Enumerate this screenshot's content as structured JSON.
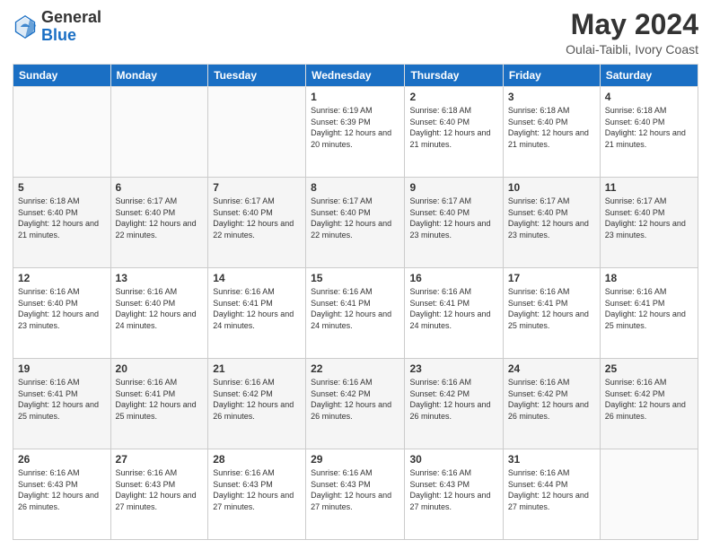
{
  "header": {
    "logo_general": "General",
    "logo_blue": "Blue",
    "month_title": "May 2024",
    "location": "Oulai-Taibli, Ivory Coast"
  },
  "weekdays": [
    "Sunday",
    "Monday",
    "Tuesday",
    "Wednesday",
    "Thursday",
    "Friday",
    "Saturday"
  ],
  "weeks": [
    [
      {
        "day": "",
        "info": ""
      },
      {
        "day": "",
        "info": ""
      },
      {
        "day": "",
        "info": ""
      },
      {
        "day": "1",
        "info": "Sunrise: 6:19 AM\nSunset: 6:39 PM\nDaylight: 12 hours and 20 minutes."
      },
      {
        "day": "2",
        "info": "Sunrise: 6:18 AM\nSunset: 6:40 PM\nDaylight: 12 hours and 21 minutes."
      },
      {
        "day": "3",
        "info": "Sunrise: 6:18 AM\nSunset: 6:40 PM\nDaylight: 12 hours and 21 minutes."
      },
      {
        "day": "4",
        "info": "Sunrise: 6:18 AM\nSunset: 6:40 PM\nDaylight: 12 hours and 21 minutes."
      }
    ],
    [
      {
        "day": "5",
        "info": "Sunrise: 6:18 AM\nSunset: 6:40 PM\nDaylight: 12 hours and 21 minutes."
      },
      {
        "day": "6",
        "info": "Sunrise: 6:17 AM\nSunset: 6:40 PM\nDaylight: 12 hours and 22 minutes."
      },
      {
        "day": "7",
        "info": "Sunrise: 6:17 AM\nSunset: 6:40 PM\nDaylight: 12 hours and 22 minutes."
      },
      {
        "day": "8",
        "info": "Sunrise: 6:17 AM\nSunset: 6:40 PM\nDaylight: 12 hours and 22 minutes."
      },
      {
        "day": "9",
        "info": "Sunrise: 6:17 AM\nSunset: 6:40 PM\nDaylight: 12 hours and 23 minutes."
      },
      {
        "day": "10",
        "info": "Sunrise: 6:17 AM\nSunset: 6:40 PM\nDaylight: 12 hours and 23 minutes."
      },
      {
        "day": "11",
        "info": "Sunrise: 6:17 AM\nSunset: 6:40 PM\nDaylight: 12 hours and 23 minutes."
      }
    ],
    [
      {
        "day": "12",
        "info": "Sunrise: 6:16 AM\nSunset: 6:40 PM\nDaylight: 12 hours and 23 minutes."
      },
      {
        "day": "13",
        "info": "Sunrise: 6:16 AM\nSunset: 6:40 PM\nDaylight: 12 hours and 24 minutes."
      },
      {
        "day": "14",
        "info": "Sunrise: 6:16 AM\nSunset: 6:41 PM\nDaylight: 12 hours and 24 minutes."
      },
      {
        "day": "15",
        "info": "Sunrise: 6:16 AM\nSunset: 6:41 PM\nDaylight: 12 hours and 24 minutes."
      },
      {
        "day": "16",
        "info": "Sunrise: 6:16 AM\nSunset: 6:41 PM\nDaylight: 12 hours and 24 minutes."
      },
      {
        "day": "17",
        "info": "Sunrise: 6:16 AM\nSunset: 6:41 PM\nDaylight: 12 hours and 25 minutes."
      },
      {
        "day": "18",
        "info": "Sunrise: 6:16 AM\nSunset: 6:41 PM\nDaylight: 12 hours and 25 minutes."
      }
    ],
    [
      {
        "day": "19",
        "info": "Sunrise: 6:16 AM\nSunset: 6:41 PM\nDaylight: 12 hours and 25 minutes."
      },
      {
        "day": "20",
        "info": "Sunrise: 6:16 AM\nSunset: 6:41 PM\nDaylight: 12 hours and 25 minutes."
      },
      {
        "day": "21",
        "info": "Sunrise: 6:16 AM\nSunset: 6:42 PM\nDaylight: 12 hours and 26 minutes."
      },
      {
        "day": "22",
        "info": "Sunrise: 6:16 AM\nSunset: 6:42 PM\nDaylight: 12 hours and 26 minutes."
      },
      {
        "day": "23",
        "info": "Sunrise: 6:16 AM\nSunset: 6:42 PM\nDaylight: 12 hours and 26 minutes."
      },
      {
        "day": "24",
        "info": "Sunrise: 6:16 AM\nSunset: 6:42 PM\nDaylight: 12 hours and 26 minutes."
      },
      {
        "day": "25",
        "info": "Sunrise: 6:16 AM\nSunset: 6:42 PM\nDaylight: 12 hours and 26 minutes."
      }
    ],
    [
      {
        "day": "26",
        "info": "Sunrise: 6:16 AM\nSunset: 6:43 PM\nDaylight: 12 hours and 26 minutes."
      },
      {
        "day": "27",
        "info": "Sunrise: 6:16 AM\nSunset: 6:43 PM\nDaylight: 12 hours and 27 minutes."
      },
      {
        "day": "28",
        "info": "Sunrise: 6:16 AM\nSunset: 6:43 PM\nDaylight: 12 hours and 27 minutes."
      },
      {
        "day": "29",
        "info": "Sunrise: 6:16 AM\nSunset: 6:43 PM\nDaylight: 12 hours and 27 minutes."
      },
      {
        "day": "30",
        "info": "Sunrise: 6:16 AM\nSunset: 6:43 PM\nDaylight: 12 hours and 27 minutes."
      },
      {
        "day": "31",
        "info": "Sunrise: 6:16 AM\nSunset: 6:44 PM\nDaylight: 12 hours and 27 minutes."
      },
      {
        "day": "",
        "info": ""
      }
    ]
  ]
}
